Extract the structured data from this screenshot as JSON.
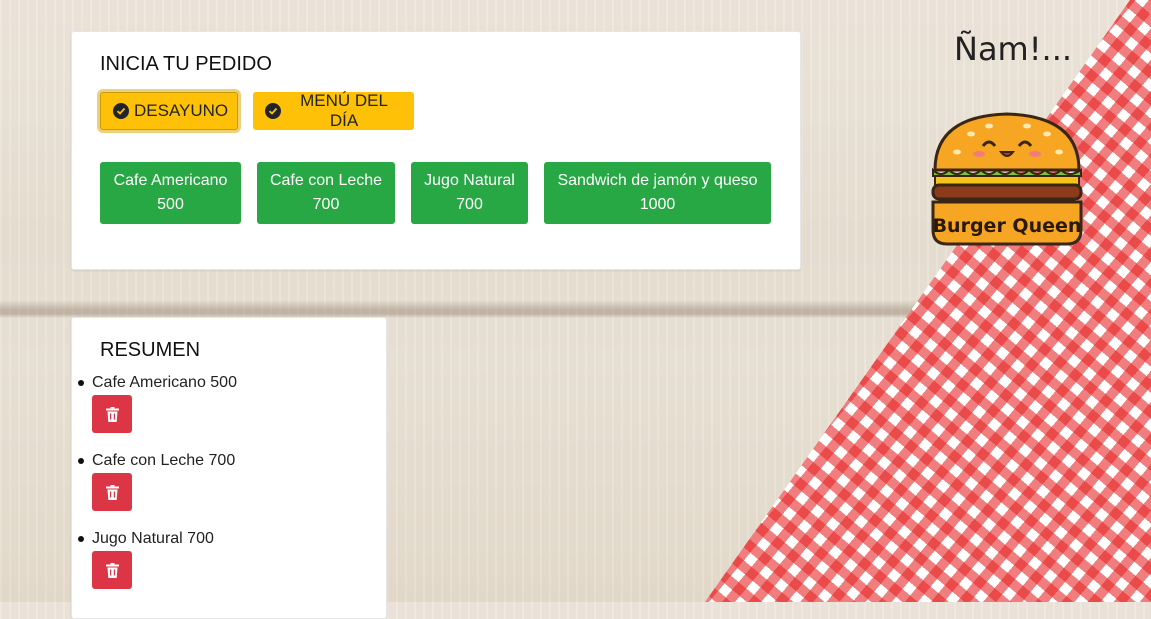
{
  "order": {
    "title": "INICIA TU PEDIDO",
    "tabs": [
      {
        "label": "DESAYUNO",
        "active": true
      },
      {
        "label": "MENÚ DEL DÍA",
        "active": false
      }
    ],
    "products": [
      {
        "name": "Cafe Americano",
        "price": "500"
      },
      {
        "name": "Cafe con Leche",
        "price": "700"
      },
      {
        "name": "Jugo Natural",
        "price": "700"
      },
      {
        "name": "Sandwich de jamón y queso",
        "price": "1000"
      }
    ]
  },
  "summary": {
    "title": "RESUMEN",
    "items": [
      {
        "text": "Cafe Americano 500"
      },
      {
        "text": "Cafe con Leche 700"
      },
      {
        "text": "Jugo Natural 700"
      }
    ]
  },
  "brand": {
    "tagline": "Ñam!...",
    "logo_text": "Burger Queen"
  },
  "colors": {
    "tab": "#ffc107",
    "product": "#28a745",
    "delete": "#dc3545"
  },
  "icons": {
    "tab": "check-circle-icon",
    "delete": "trash-icon"
  }
}
